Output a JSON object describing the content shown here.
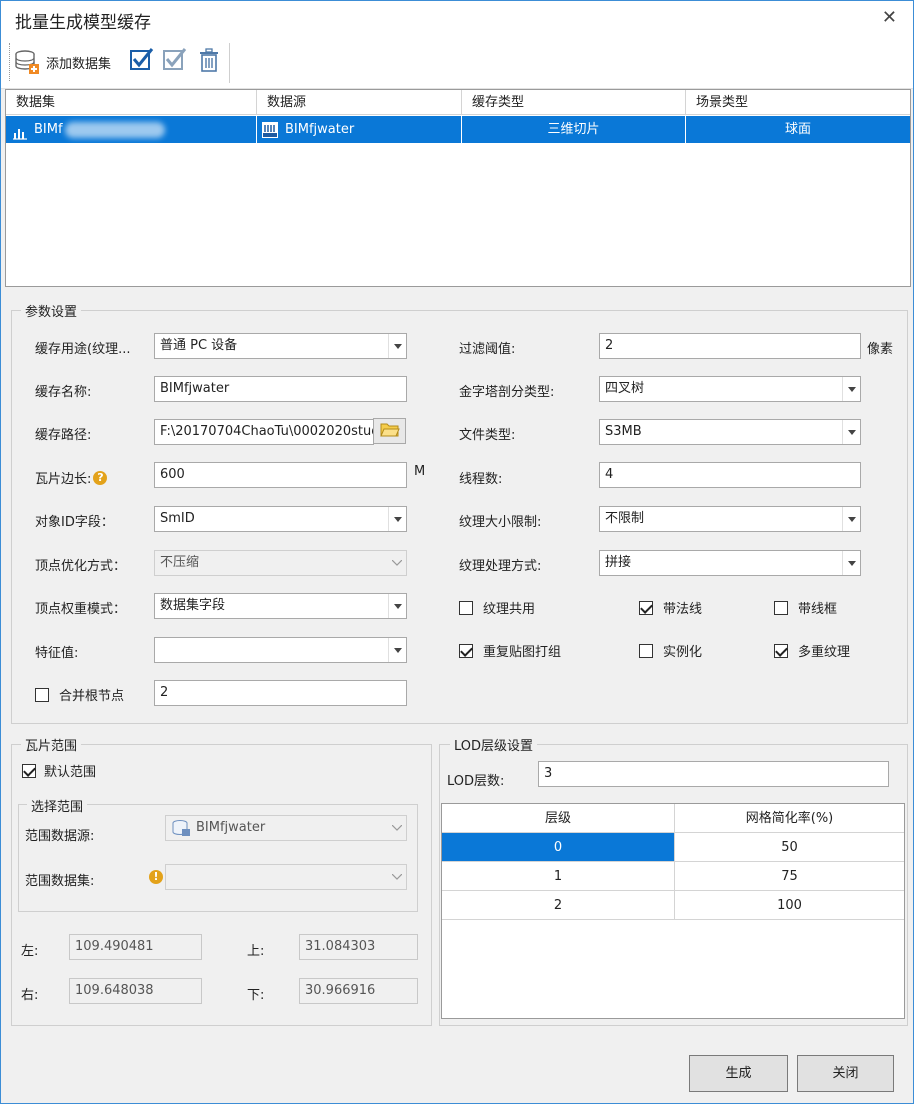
{
  "window": {
    "title": "批量生成模型缓存",
    "close_glyph": "✕"
  },
  "toolbar": {
    "add_dataset": "添加数据集"
  },
  "dataset_grid": {
    "columns": [
      "数据集",
      "数据源",
      "缓存类型",
      "场景类型"
    ],
    "rows": [
      {
        "dataset": "BIMf",
        "datasource": "BIMfjwater",
        "cache_type": "三维切片",
        "scene_type": "球面"
      }
    ]
  },
  "params": {
    "legend": "参数设置",
    "cache_usage": {
      "label": "缓存用途(纹理...",
      "value": "普通 PC 设备"
    },
    "cache_name": {
      "label": "缓存名称:",
      "value": "BIMfjwater"
    },
    "cache_path": {
      "label": "缓存路径:",
      "value": "F:\\20170704ChaoTu\\0002020stud"
    },
    "tile_size": {
      "label": "瓦片边长:",
      "value": "600",
      "unit": "M"
    },
    "object_id_field": {
      "label": "对象ID字段：",
      "value": "SmID"
    },
    "vertex_optimize": {
      "label": "顶点优化方式：",
      "value": "不压缩"
    },
    "vertex_weight": {
      "label": "顶点权重模式：",
      "value": "数据集字段"
    },
    "feature_value": {
      "label": "特征值:",
      "value": ""
    },
    "merge_root": {
      "label": "合并根节点",
      "checked": false,
      "value": "2"
    },
    "filter_threshold": {
      "label": "过滤阈值:",
      "value": "2",
      "unit": "像素"
    },
    "pyramid_type": {
      "label": "金字塔剖分类型:",
      "value": "四叉树"
    },
    "file_type": {
      "label": "文件类型:",
      "value": "S3MB"
    },
    "thread_count": {
      "label": "线程数:",
      "value": "4"
    },
    "texture_size_limit": {
      "label": "纹理大小限制:",
      "value": "不限制"
    },
    "texture_process": {
      "label": "纹理处理方式:",
      "value": "拼接"
    },
    "checks": [
      {
        "label": "纹理共用",
        "checked": false
      },
      {
        "label": "带法线",
        "checked": true
      },
      {
        "label": "带线框",
        "checked": false
      },
      {
        "label": "重复贴图打组",
        "checked": true
      },
      {
        "label": "实例化",
        "checked": false
      },
      {
        "label": "多重纹理",
        "checked": true
      }
    ]
  },
  "tile_range": {
    "legend": "瓦片范围",
    "default_range": {
      "label": "默认范围",
      "checked": true
    },
    "select_legend": "选择范围",
    "range_datasource": {
      "label": "范围数据源:",
      "value": "BIMfjwater"
    },
    "range_dataset": {
      "label": "范围数据集:",
      "value": ""
    },
    "left": {
      "label": "左:",
      "value": "109.490481"
    },
    "top": {
      "label": "上:",
      "value": "31.084303"
    },
    "right": {
      "label": "右:",
      "value": "109.648038"
    },
    "bottom": {
      "label": "下:",
      "value": "30.966916"
    }
  },
  "lod": {
    "legend": "LOD层级设置",
    "count_label": "LOD层数:",
    "count_value": "3",
    "columns": [
      "层级",
      "网格简化率(%)"
    ],
    "rows": [
      {
        "level": "0",
        "rate": "50"
      },
      {
        "level": "1",
        "rate": "75"
      },
      {
        "level": "2",
        "rate": "100"
      }
    ]
  },
  "footer": {
    "generate": "生成",
    "close": "关闭"
  },
  "colors": {
    "selection": "#0a78d7",
    "warning": "#e3a21a"
  }
}
